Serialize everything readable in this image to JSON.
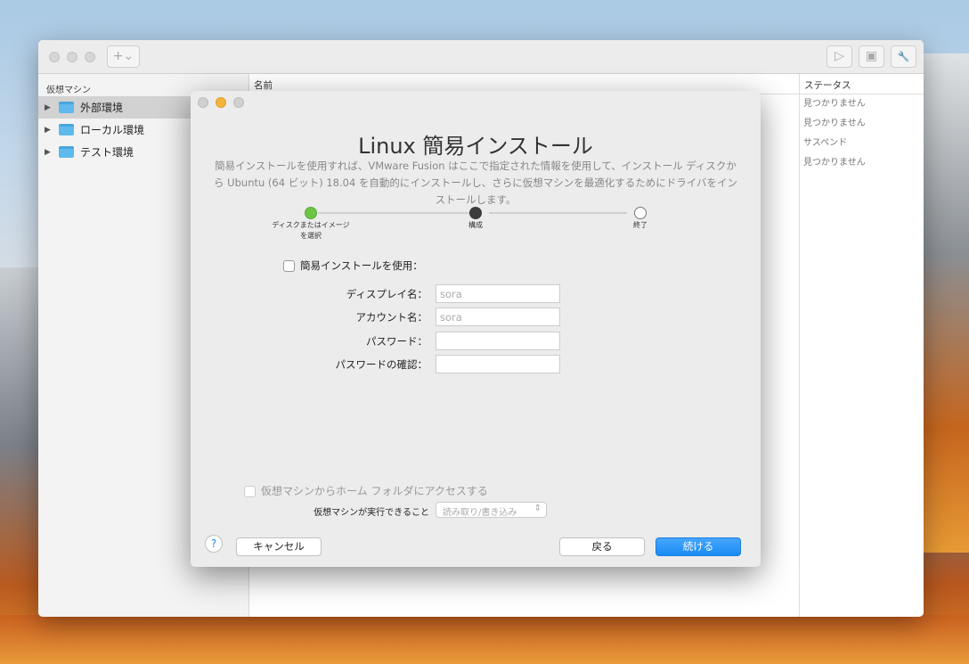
{
  "sidebar": {
    "header": "仮想マシン",
    "items": [
      {
        "label": "外部環境"
      },
      {
        "label": "ローカル環境"
      },
      {
        "label": "テスト環境"
      }
    ]
  },
  "columns": {
    "name": "名前",
    "status": "ステータス"
  },
  "statuses": [
    "見つかりません",
    "見つかりません",
    "サスペンド",
    "見つかりません"
  ],
  "toolbar": {
    "add_label": "+⌄",
    "play": "▷",
    "snapshot": "▣",
    "settings": "🔧"
  },
  "dialog": {
    "title": "Linux 簡易インストール",
    "description": "簡易インストールを使用すれば、VMware Fusion はここで指定された情報を使用して、インストール ディスクから Ubuntu (64 ビット) 18.04 を自動的にインストールし、さらに仮想マシンを最適化するためにドライバをインストールします。",
    "steps": [
      {
        "label": "ディスクまたはイメージを選択"
      },
      {
        "label": "構成"
      },
      {
        "label": "終了"
      }
    ],
    "easy_install_label": "簡易インストールを使用：",
    "fields": [
      {
        "label": "ディスプレイ名：",
        "value": "sora"
      },
      {
        "label": "アカウント名：",
        "value": "sora"
      },
      {
        "label": "パスワード：",
        "value": ""
      },
      {
        "label": "パスワードの確認：",
        "value": ""
      }
    ],
    "home_folder_label": "仮想マシンからホーム フォルダにアクセスする",
    "access_label": "仮想マシンが実行できること",
    "access_value": "読み取り/書き込み",
    "help": "?",
    "cancel": "キャンセル",
    "back": "戻る",
    "continue": "続ける"
  },
  "colors": {
    "accent": "#1a8cf5",
    "step_done": "#6cc644",
    "step_current": "#3c3c3c"
  }
}
